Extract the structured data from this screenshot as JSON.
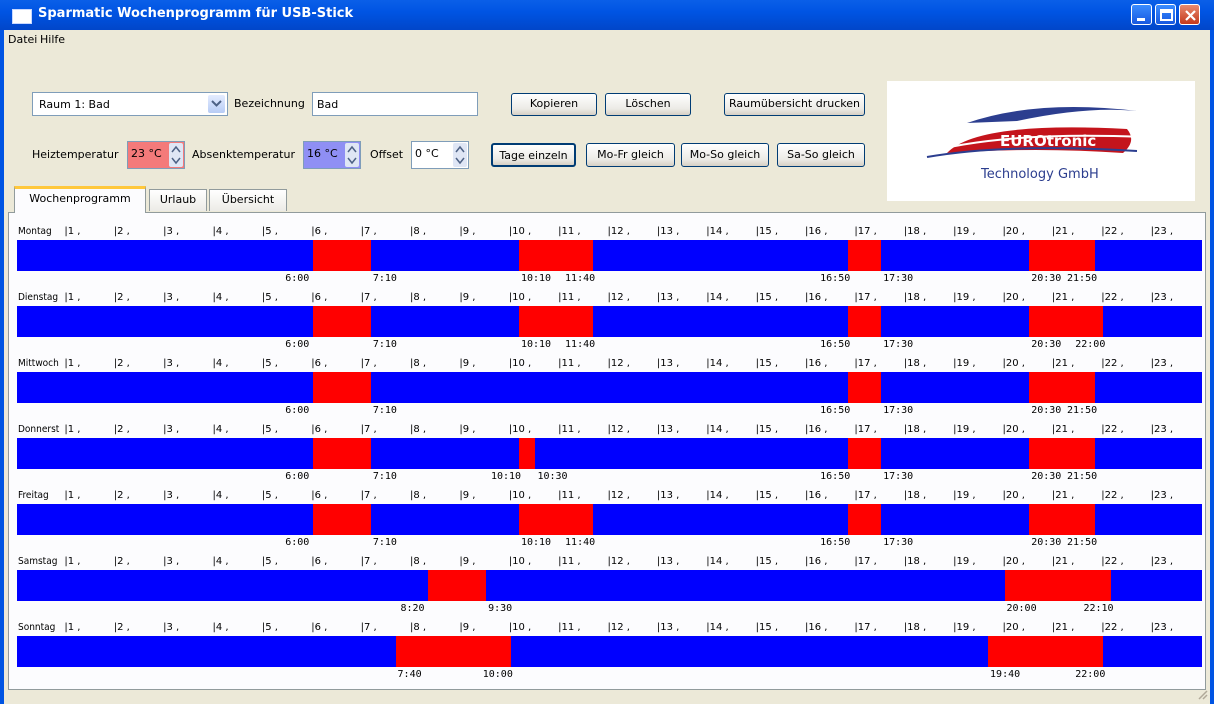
{
  "window": {
    "title": "Sparmatic Wochenprogramm für USB-Stick",
    "controls": [
      "minimize",
      "maximize",
      "close"
    ]
  },
  "menu": {
    "items": [
      "Datei",
      "Hilfe"
    ]
  },
  "room": {
    "selected": "Raum 1: Bad",
    "bezeichnung_label": "Bezeichnung",
    "bezeichnung_value": "Bad"
  },
  "buttons": {
    "kopieren": "Kopieren",
    "loeschen": "Löschen",
    "raumuebersicht": "Raumübersicht drucken",
    "tage_einzeln": "Tage einzeln",
    "mo_fr": "Mo-Fr gleich",
    "mo_so": "Mo-So gleich",
    "sa_so": "Sa-So gleich"
  },
  "temps": {
    "heiz_label": "Heiztemperatur",
    "heiz_value": "23 °C",
    "heiz_color": "#f47a7a",
    "absenk_label": "Absenktemperatur",
    "absenk_value": "16 °C",
    "absenk_color": "#8f8ff4",
    "offset_label": "Offset",
    "offset_value": "0 °C"
  },
  "logo": {
    "brand": "EUROtronic",
    "sub": "Technology GmbH"
  },
  "tabs": [
    "Wochenprogramm",
    "Urlaub",
    "Übersicht"
  ],
  "colors": {
    "heat": "#ff0000",
    "lower": "#0000ff"
  },
  "hours": [
    "1",
    "2",
    "3",
    "4",
    "5",
    "6",
    "7",
    "8",
    "9",
    "10",
    "11",
    "12",
    "13",
    "14",
    "15",
    "16",
    "17",
    "18",
    "19",
    "20",
    "21",
    "22",
    "23"
  ],
  "days": [
    {
      "name": "Montag",
      "periods": [
        [
          "6:00",
          "7:10"
        ],
        [
          "10:10",
          "11:40"
        ],
        [
          "16:50",
          "17:30"
        ],
        [
          "20:30",
          "21:50"
        ]
      ]
    },
    {
      "name": "Dienstag",
      "periods": [
        [
          "6:00",
          "7:10"
        ],
        [
          "10:10",
          "11:40"
        ],
        [
          "16:50",
          "17:30"
        ],
        [
          "20:30",
          "22:00"
        ]
      ]
    },
    {
      "name": "Mittwoch",
      "periods": [
        [
          "6:00",
          "7:10"
        ],
        [
          "16:50",
          "17:30"
        ],
        [
          "20:30",
          "21:50"
        ]
      ]
    },
    {
      "name": "Donnerst",
      "periods": [
        [
          "6:00",
          "7:10"
        ],
        [
          "10:10",
          "10:30"
        ],
        [
          "16:50",
          "17:30"
        ],
        [
          "20:30",
          "21:50"
        ]
      ]
    },
    {
      "name": "Freitag",
      "periods": [
        [
          "6:00",
          "7:10"
        ],
        [
          "10:10",
          "11:40"
        ],
        [
          "16:50",
          "17:30"
        ],
        [
          "20:30",
          "21:50"
        ]
      ]
    },
    {
      "name": "Samstag",
      "periods": [
        [
          "8:20",
          "9:30"
        ],
        [
          "20:00",
          "22:10"
        ]
      ]
    },
    {
      "name": "Sonntag",
      "periods": [
        [
          "7:40",
          "10:00"
        ],
        [
          "19:40",
          "22:00"
        ]
      ]
    }
  ]
}
